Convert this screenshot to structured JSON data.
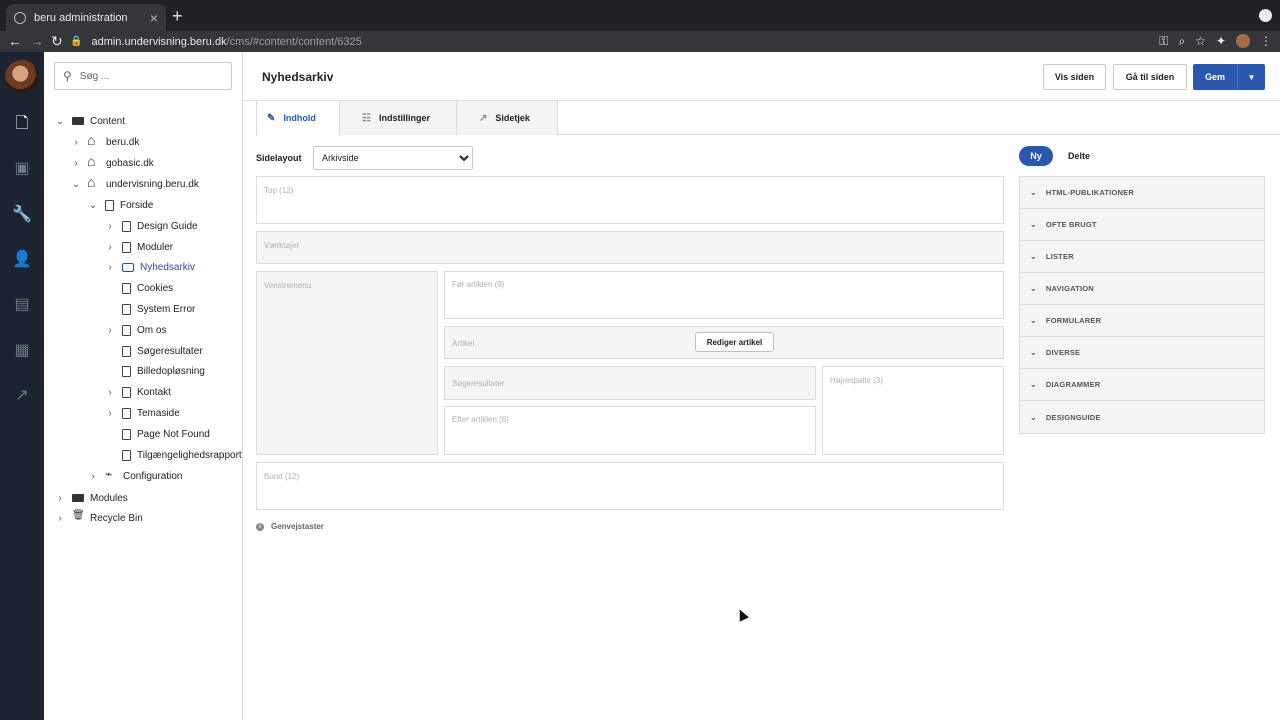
{
  "browser": {
    "tab_title": "beru administration",
    "url_host": "admin.undervisning.beru.dk",
    "url_path": "/cms/#content/content/6325"
  },
  "search": {
    "placeholder": "Søg ..."
  },
  "tree": {
    "root": "Content",
    "sites": [
      "beru.dk",
      "gobasic.dk",
      "undervisning.beru.dk"
    ],
    "forside": "Forside",
    "pages": [
      "Design Guide",
      "Moduler",
      "Nyhedsarkiv",
      "Cookies",
      "System Error",
      "Om os",
      "Søgeresultater",
      "Billedopløsning",
      "Kontakt",
      "Temaside",
      "Page Not Found",
      "Tilgængelighedsrapport"
    ],
    "configuration": "Configuration",
    "modules": "Modules",
    "recycle_bin": "Recycle Bin"
  },
  "header": {
    "title": "Nyhedsarkiv",
    "view_label": "Vis siden",
    "goto_label": "Gå til siden",
    "save_label": "Gem"
  },
  "tabs": [
    "Indhold",
    "Indstillinger",
    "Sidetjek"
  ],
  "layout": {
    "label": "Sidelayout",
    "selected": "Arkivside"
  },
  "zones": {
    "top": "Top (12)",
    "tools": "Værktøjer",
    "left_menu": "Venstremenu",
    "before_article": "Før artiklen (9)",
    "article": "Artikel",
    "edit_article": "Rediger artikel",
    "search_results": "Søgeresultater",
    "after_article": "Efter artiklen (6)",
    "right_column": "Højrespalte (3)",
    "bottom": "Bund (12)"
  },
  "shortcuts_label": "Genvejstaster",
  "panel": {
    "new_label": "Ny",
    "shared_label": "Delte",
    "sections": [
      "HTML-PUBLIKATIONER",
      "OFTE BRUGT",
      "LISTER",
      "NAVIGATION",
      "FORMULARER",
      "DIVERSE",
      "DIAGRAMMER",
      "DESIGNGUIDE"
    ]
  },
  "colors": {
    "accent": "#2957ae",
    "rail": "#1b2430"
  }
}
